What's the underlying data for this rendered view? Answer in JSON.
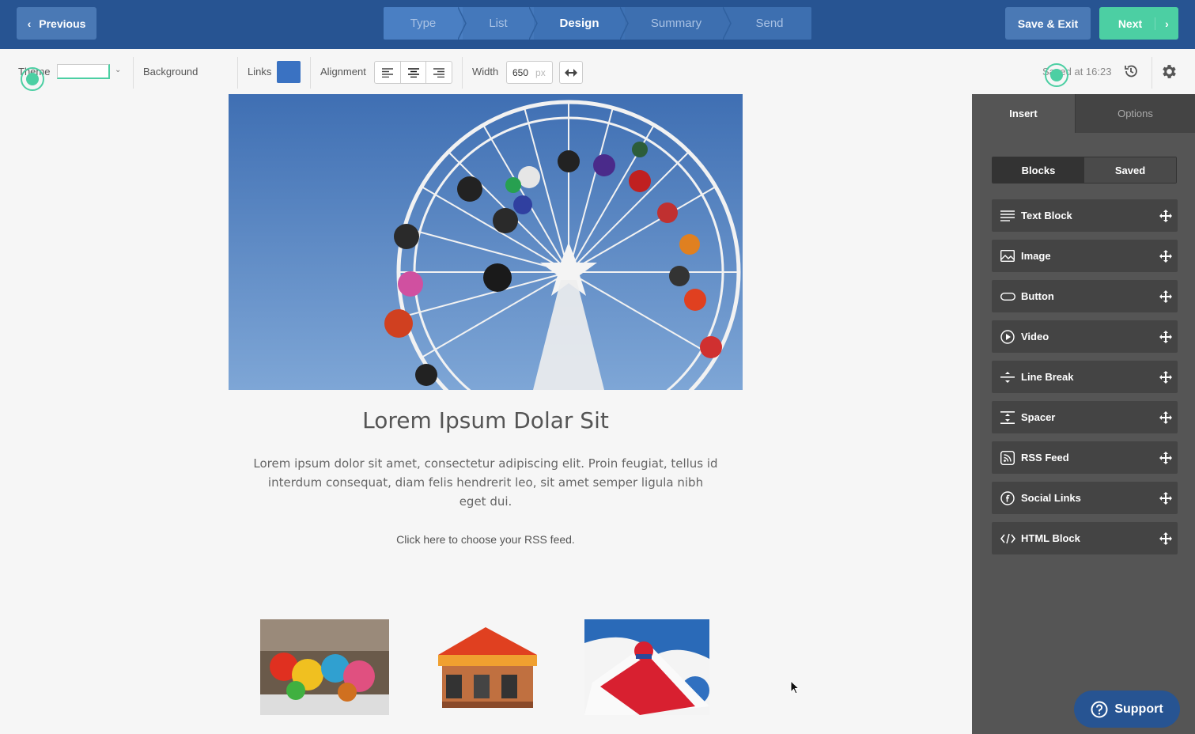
{
  "topbar": {
    "previous_label": "Previous",
    "steps": [
      {
        "label": "Type"
      },
      {
        "label": "List"
      },
      {
        "label": "Design"
      },
      {
        "label": "Summary"
      },
      {
        "label": "Send"
      }
    ],
    "active_step": "Design",
    "save_exit_label": "Save & Exit",
    "next_label": "Next"
  },
  "toolbar": {
    "theme_label": "Theme",
    "background_label": "Background",
    "links_label": "Links",
    "links_color": "#3a72c2",
    "alignment_label": "Alignment",
    "width_label": "Width",
    "width_value": "650",
    "width_unit": "px",
    "saved_status": "Saved at 16:23"
  },
  "canvas": {
    "title": "Lorem Ipsum Dolar Sit",
    "paragraph": "Lorem ipsum dolor sit amet, consectetur adipiscing elit. Proin feugiat, tellus id interdum consequat, diam felis hendrerit leo, sit amet semper ligula nibh eget dui.",
    "rss_prompt": "Click here to choose your RSS feed."
  },
  "panel": {
    "tabs": {
      "insert": "Insert",
      "options": "Options"
    },
    "subtabs": {
      "blocks": "Blocks",
      "saved": "Saved"
    },
    "blocks": [
      {
        "label": "Text Block",
        "icon": "text-lines-icon"
      },
      {
        "label": "Image",
        "icon": "image-icon"
      },
      {
        "label": "Button",
        "icon": "button-icon"
      },
      {
        "label": "Video",
        "icon": "play-icon"
      },
      {
        "label": "Line Break",
        "icon": "line-break-icon"
      },
      {
        "label": "Spacer",
        "icon": "spacer-icon"
      },
      {
        "label": "RSS Feed",
        "icon": "rss-icon"
      },
      {
        "label": "Social Links",
        "icon": "facebook-icon"
      },
      {
        "label": "HTML Block",
        "icon": "code-icon"
      }
    ]
  },
  "support_label": "Support",
  "colors": {
    "header": "#275492",
    "accent": "#4ccfa3",
    "panel": "#555555"
  }
}
